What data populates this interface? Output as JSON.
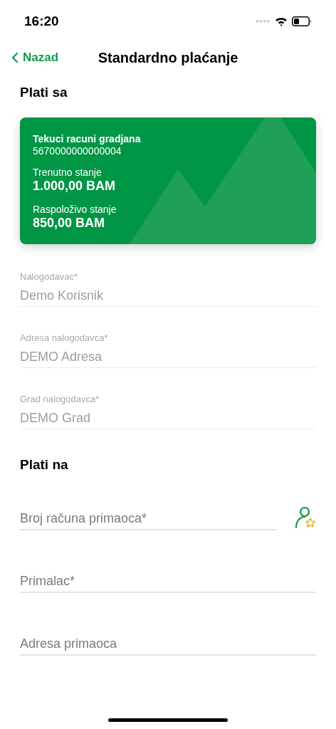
{
  "status_bar": {
    "time": "16:20"
  },
  "nav": {
    "back": "Nazad",
    "title": "Standardno plaćanje"
  },
  "payer_section": {
    "title": "Plati sa",
    "account_card": {
      "name": "Tekuci racuni gradjana",
      "number": "5670000000000004",
      "current_label": "Trenutno stanje",
      "current_value": "1.000,00 BAM",
      "available_label": "Raspoloživo stanje",
      "available_value": "850,00 BAM"
    },
    "fields": [
      {
        "label": "Nalogodavac*",
        "value": "Demo Korisnik",
        "disabled": true
      },
      {
        "label": "Adresa nalogodavca*",
        "value": "DEMO Adresa",
        "disabled": true
      },
      {
        "label": "Grad nalogodavca*",
        "value": "DEMO Grad",
        "disabled": true
      }
    ]
  },
  "payee_section": {
    "title": "Plati na",
    "fields": [
      {
        "placeholder": "Broj računa primaoca*",
        "kind": "contact"
      },
      {
        "placeholder": "Primalac*",
        "kind": "plain"
      },
      {
        "placeholder": "Adresa primaoca",
        "kind": "plain"
      }
    ]
  }
}
